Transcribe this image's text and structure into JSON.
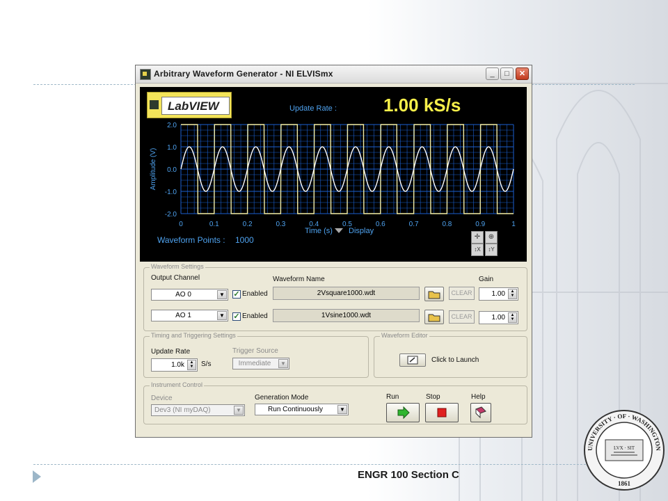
{
  "window": {
    "title": "Arbitrary Waveform Generator - NI ELVISmx",
    "minimize_glyph": "_",
    "maximize_glyph": "□",
    "close_glyph": "✕"
  },
  "display": {
    "logo_text": "LabVIEW",
    "update_rate_label": "Update Rate :",
    "update_rate_value": "1.00 kS/s",
    "waveform_points_label": "Waveform Points :",
    "waveform_points_value": "1000",
    "display_label": "Display"
  },
  "chart_data": {
    "type": "line",
    "xlabel": "Time (s)",
    "ylabel": "Amplitude (V)",
    "xlim": [
      0,
      1
    ],
    "ylim": [
      -2,
      2
    ],
    "x_ticks": [
      "0",
      "0.1",
      "0.2",
      "0.3",
      "0.4",
      "0.5",
      "0.6",
      "0.7",
      "0.8",
      "0.9",
      "1"
    ],
    "y_ticks": [
      "2.0",
      "1.0",
      "0.0",
      "-1.0",
      "-2.0"
    ],
    "grid": true,
    "series": [
      {
        "waveform": "square",
        "frequency_hz": 10,
        "amplitude": 2,
        "color": "#f2eda6"
      },
      {
        "waveform": "sine",
        "frequency_hz": 10,
        "amplitude": 1,
        "color": "#ffffff"
      }
    ],
    "background": "#000000",
    "grid_color": "#1b5fd0"
  },
  "waveform_settings": {
    "group_title": "Waveform Settings",
    "output_channel_label": "Output Channel",
    "waveform_name_label": "Waveform Name",
    "gain_label": "Gain",
    "channels": [
      {
        "channel": "AO 0",
        "enabled_label": "Enabled",
        "waveform_file": "2Vsquare1000.wdt",
        "clear_label": "CLEAR",
        "gain": "1.00"
      },
      {
        "channel": "AO 1",
        "enabled_label": "Enabled",
        "waveform_file": "1Vsine1000.wdt",
        "clear_label": "CLEAR",
        "gain": "1.00"
      }
    ]
  },
  "timing": {
    "group_title": "Timing and Triggering Settings",
    "update_rate_label": "Update Rate",
    "update_rate_value": "1.0k",
    "update_rate_unit": "S/s",
    "trigger_source_label": "Trigger Source",
    "trigger_source_value": "Immediate"
  },
  "editor": {
    "group_title": "Waveform Editor",
    "launch_label": "Click to Launch"
  },
  "instrument": {
    "group_title": "Instrument Control",
    "device_label": "Device",
    "device_value": "Dev3 (NI myDAQ)",
    "generation_mode_label": "Generation Mode",
    "generation_mode_value": "Run Continuously",
    "run_label": "Run",
    "stop_label": "Stop",
    "help_label": "Help"
  },
  "slide": {
    "footer_text": "ENGR 100 Section C",
    "seal_top_text": "UNIVERSITY · OF · WASHINGTON",
    "seal_bottom_text": "1861",
    "seal_banner": "LVX · SIT"
  }
}
